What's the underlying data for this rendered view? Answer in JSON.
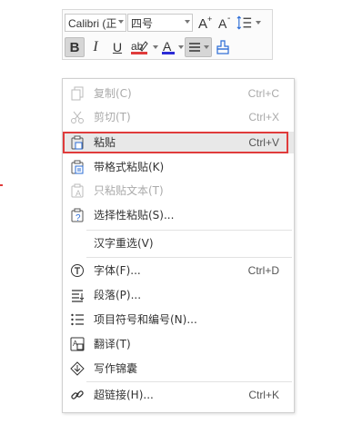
{
  "toolbar": {
    "font_name": "Calibri (正",
    "font_size": "四号",
    "bold": "B",
    "italic": "I",
    "underline": "U",
    "font_color_letter": "A",
    "font_color": "#2b2bd6",
    "highlight_color": "#e03b3b"
  },
  "menu": {
    "items": [
      {
        "label": "复制(C)",
        "shortcut": "Ctrl+C",
        "icon": "copy-icon",
        "enabled": false
      },
      {
        "label": "剪切(T)",
        "shortcut": "Ctrl+X",
        "icon": "cut-icon",
        "enabled": false
      },
      {
        "label": "粘贴",
        "shortcut": "Ctrl+V",
        "icon": "paste-icon",
        "enabled": true,
        "highlighted": true
      },
      {
        "label": "带格式粘贴(K)",
        "shortcut": "",
        "icon": "paste-formatted-icon",
        "enabled": true
      },
      {
        "label": "只粘贴文本(T)",
        "shortcut": "",
        "icon": "paste-text-icon",
        "enabled": false
      },
      {
        "label": "选择性粘贴(S)...",
        "shortcut": "",
        "icon": "paste-special-icon",
        "enabled": true
      },
      {
        "label": "汉字重选(V)",
        "shortcut": "",
        "icon": "",
        "enabled": true
      },
      {
        "label": "字体(F)...",
        "shortcut": "Ctrl+D",
        "icon": "font-icon",
        "enabled": true
      },
      {
        "label": "段落(P)...",
        "shortcut": "",
        "icon": "paragraph-icon",
        "enabled": true
      },
      {
        "label": "项目符号和编号(N)...",
        "shortcut": "",
        "icon": "bullets-icon",
        "enabled": true
      },
      {
        "label": "翻译(T)",
        "shortcut": "",
        "icon": "translate-icon",
        "enabled": true
      },
      {
        "label": "写作锦囊",
        "shortcut": "",
        "icon": "writing-tips-icon",
        "enabled": true
      },
      {
        "label": "超链接(H)...",
        "shortcut": "Ctrl+K",
        "icon": "hyperlink-icon",
        "enabled": true
      }
    ]
  }
}
